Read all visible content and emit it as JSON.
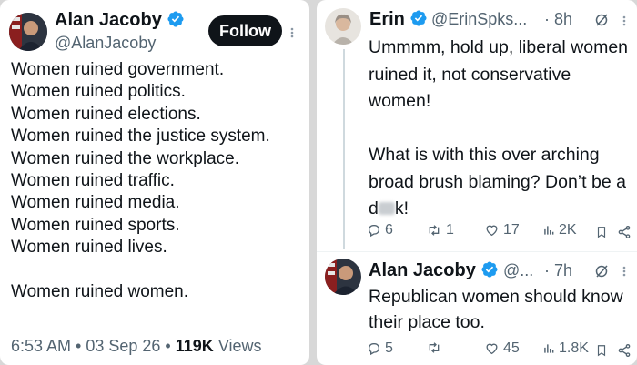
{
  "left_post": {
    "author_name": "Alan Jacoby",
    "author_handle": "@AlanJacoby",
    "follow_label": "Follow",
    "text": "Women ruined government.\nWomen ruined politics.\nWomen ruined elections.\nWomen ruined the justice system.\nWomen ruined the workplace.\nWomen ruined traffic.\nWomen ruined media.\nWomen ruined sports.\nWomen ruined lives.\n\nWomen ruined women.",
    "timestamp": "6:53 AM • 03 Sep 26 •",
    "views_count": "119K",
    "views_label": "Views"
  },
  "reply_1": {
    "author_name": "Erin",
    "author_handle": "@ErinSpks...",
    "time": "· 8h",
    "text_part1": "Ummmm, hold up, liberal women ruined it, not conservative women!\n\nWhat is with this over arching broad brush blaming? Don’t be a d",
    "text_part2": "k!",
    "replies": "6",
    "reposts": "1",
    "likes": "17",
    "views": "2K"
  },
  "reply_2": {
    "author_name": "Alan Jacoby",
    "author_handle": "@...",
    "time": "· 7h",
    "text": "Republican women should know their place too.",
    "replies": "5",
    "reposts": "",
    "likes": "45",
    "views": "1.8K"
  },
  "colors": {
    "verified_blue": "#1d9bf0",
    "text_primary": "#0f1419",
    "text_secondary": "#536471"
  }
}
